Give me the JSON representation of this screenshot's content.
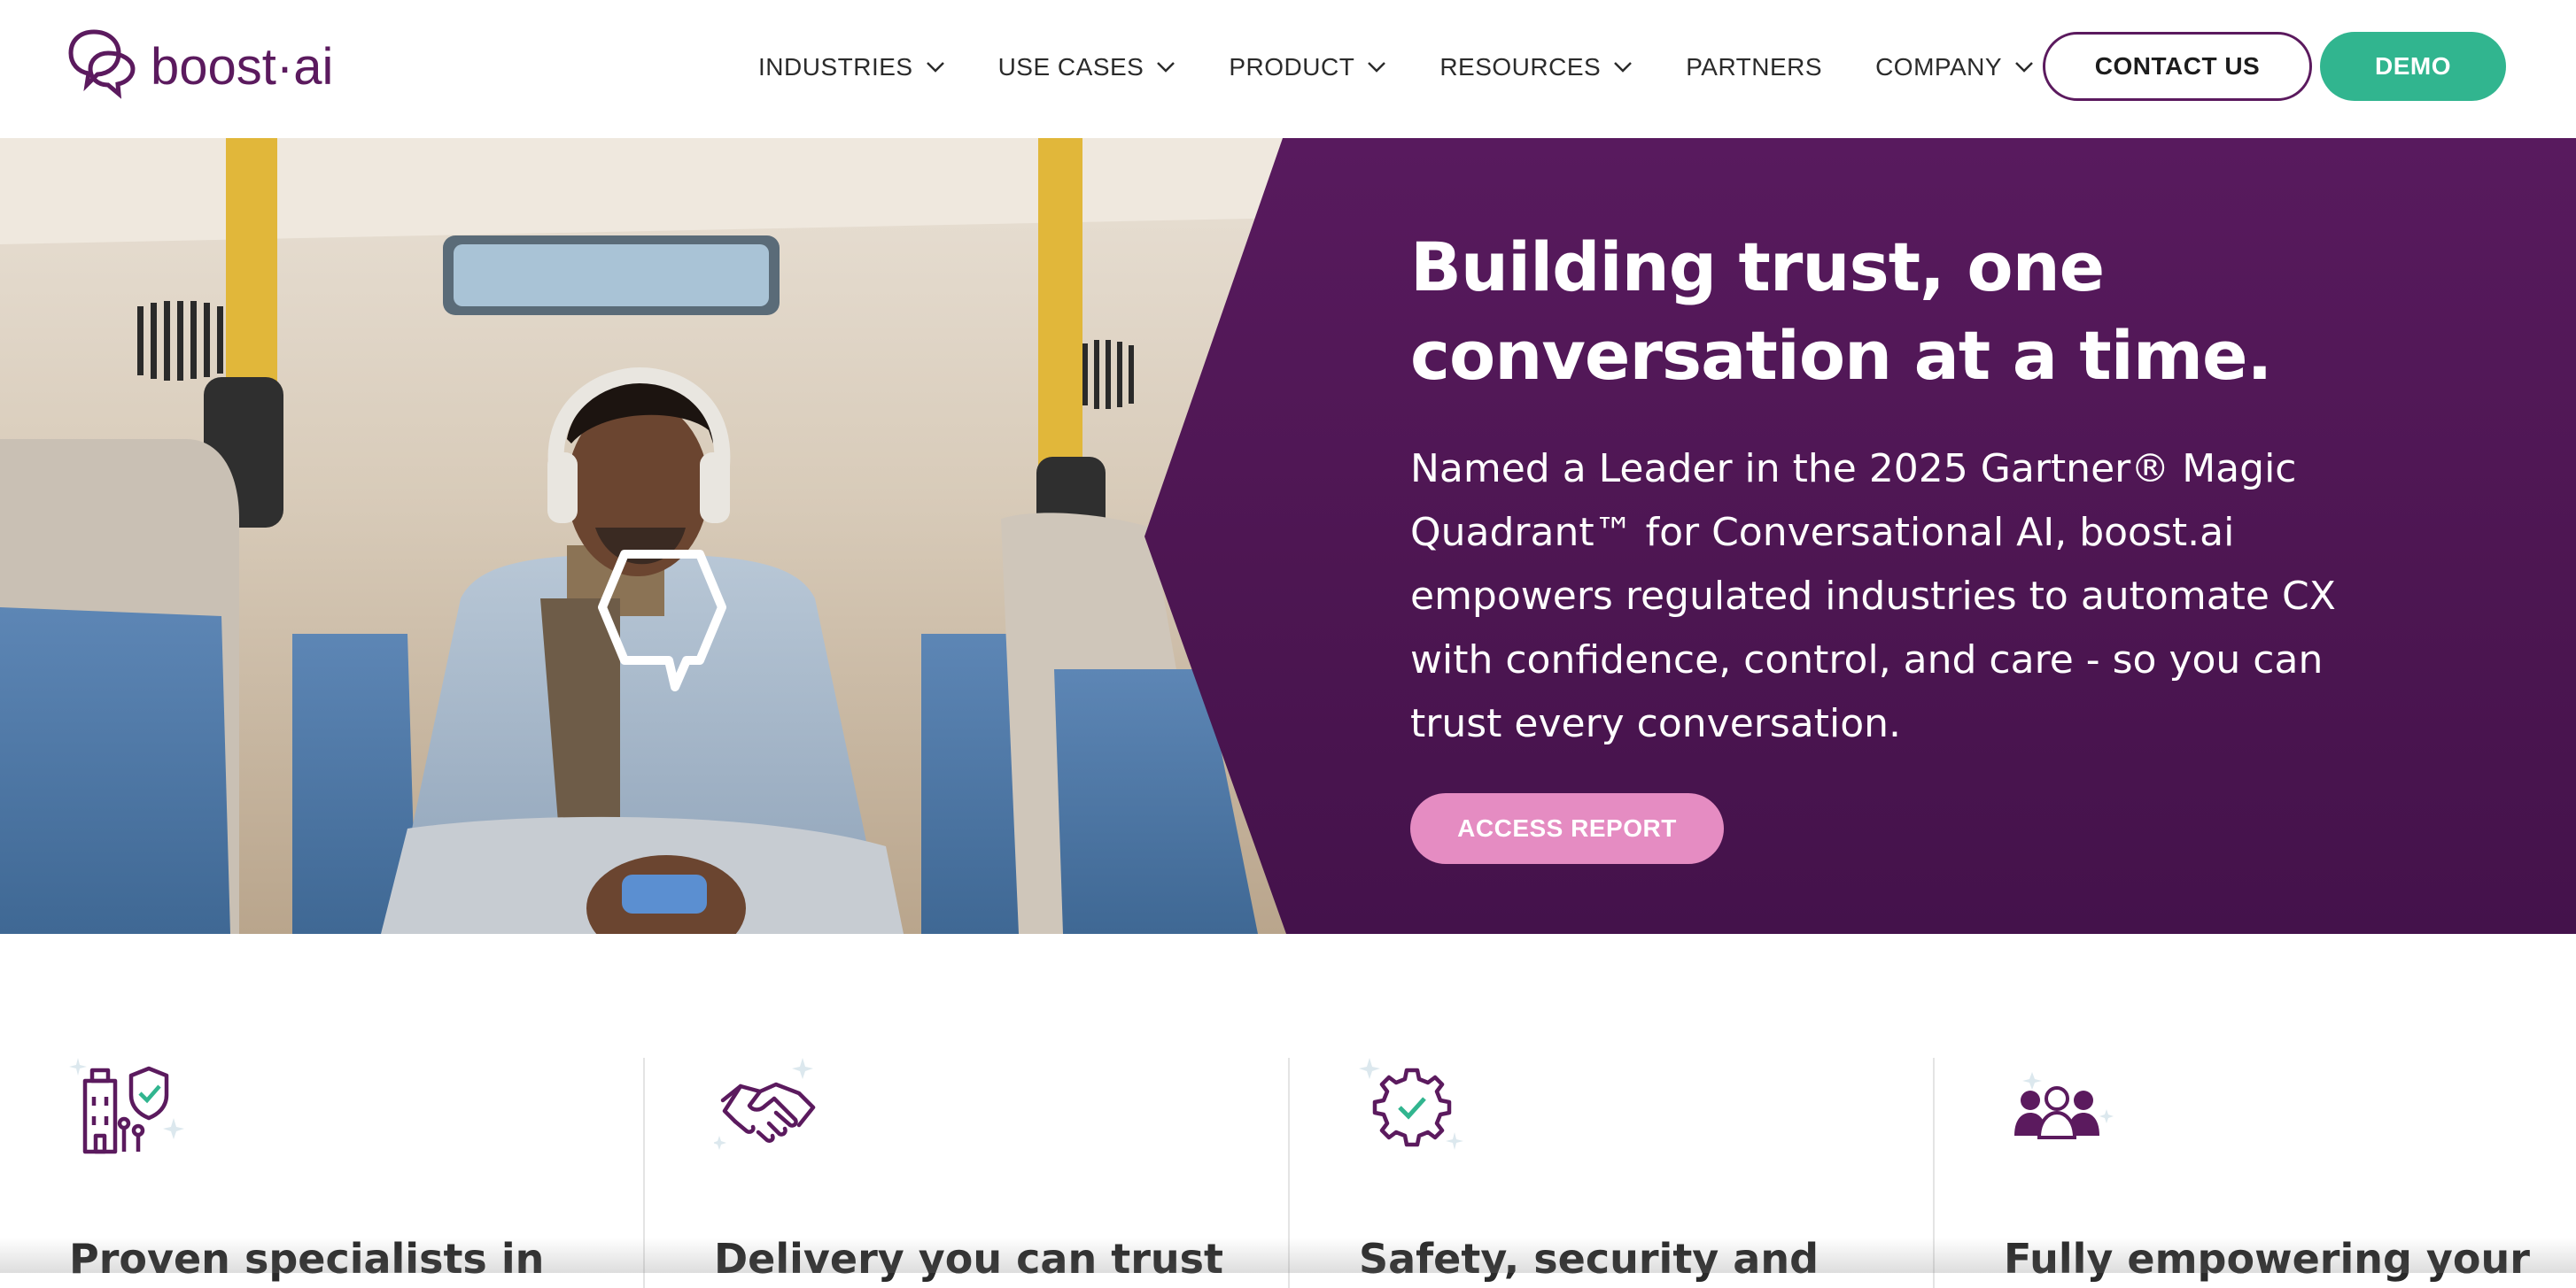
{
  "brand": {
    "logo_text": "boost·ai",
    "primary_color": "#5b1a5e",
    "accent_green": "#31b58f",
    "accent_pink": "#e58cc2"
  },
  "nav": {
    "items": [
      {
        "label": "INDUSTRIES",
        "has_dropdown": true
      },
      {
        "label": "USE CASES",
        "has_dropdown": true
      },
      {
        "label": "PRODUCT",
        "has_dropdown": true
      },
      {
        "label": "RESOURCES",
        "has_dropdown": true
      },
      {
        "label": "PARTNERS",
        "has_dropdown": false
      },
      {
        "label": "COMPANY",
        "has_dropdown": true
      }
    ],
    "contact_label": "CONTACT US",
    "demo_label": "DEMO"
  },
  "hero": {
    "title": "Building trust, one conversation at a time.",
    "description": "Named a Leader in the 2025 Gartner® Magic Quadrant™ for Conversational AI, boost.ai empowers regulated industries to automate CX with confidence, control, and care - so you can trust every conversation.",
    "cta_label": "ACCESS REPORT",
    "image": "man-with-headphones-on-bus-using-phone"
  },
  "features": [
    {
      "title": "Proven specialists in",
      "icon": "building-shield-icon"
    },
    {
      "title": "Delivery you can trust",
      "icon": "handshake-icon"
    },
    {
      "title": "Safety, security and",
      "icon": "gear-check-icon"
    },
    {
      "title": "Fully empowering your",
      "icon": "team-people-icon"
    }
  ]
}
